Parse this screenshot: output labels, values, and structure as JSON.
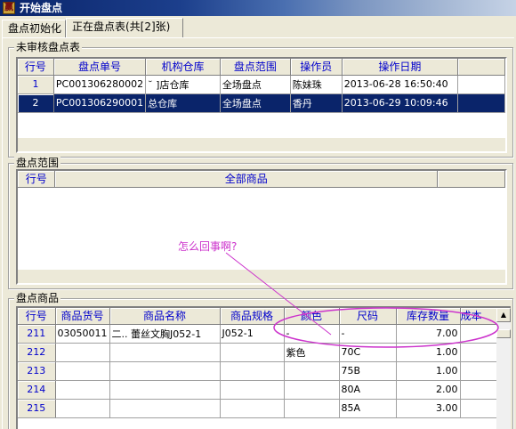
{
  "window": {
    "title": "开始盘点"
  },
  "tabs": [
    {
      "label": "盘点初始化"
    },
    {
      "label": "正在盘点表(共[2]张)"
    }
  ],
  "pending": {
    "legend": "未审核盘点表",
    "columns": [
      "行号",
      "盘点单号",
      "机构仓库",
      "盘点范围",
      "操作员",
      "操作日期"
    ],
    "rows": [
      {
        "no": "1",
        "doc": "PC001306280002",
        "store": "˘        ]店仓库",
        "range": "全场盘点",
        "op": "陈妹珠",
        "date": "2013-06-28 16:50:40"
      },
      {
        "no": "2",
        "doc": "PC001306290001",
        "store": "总仓库",
        "range": "全场盘点",
        "op": "香丹",
        "date": "2013-06-29 10:09:46"
      }
    ]
  },
  "scope": {
    "legend": "盘点范围",
    "columns": [
      "行号",
      "全部商品"
    ]
  },
  "annotation": {
    "text": "怎么回事啊?",
    "color": "#cc33cc"
  },
  "goods": {
    "legend": "盘点商品",
    "columns": [
      "行号",
      "商品货号",
      "商品名称",
      "商品规格",
      "颜色",
      "尺码",
      "库存数量",
      "成本"
    ],
    "rows": [
      {
        "no": "211",
        "code": "03050011",
        "name": "二.. 蕾丝文胸J052-1",
        "spec": "J052-1",
        "color": "-",
        "size": "-",
        "qty": "7.00"
      },
      {
        "no": "212",
        "code": "",
        "name": "",
        "spec": "",
        "color": "紫色",
        "size": "70C",
        "qty": "1.00"
      },
      {
        "no": "213",
        "code": "",
        "name": "",
        "spec": "",
        "color": "",
        "size": "75B",
        "qty": "1.00"
      },
      {
        "no": "214",
        "code": "",
        "name": "",
        "spec": "",
        "color": "",
        "size": "80A",
        "qty": "2.00"
      },
      {
        "no": "215",
        "code": "",
        "name": "",
        "spec": "",
        "color": "",
        "size": "85A",
        "qty": "3.00"
      }
    ]
  }
}
